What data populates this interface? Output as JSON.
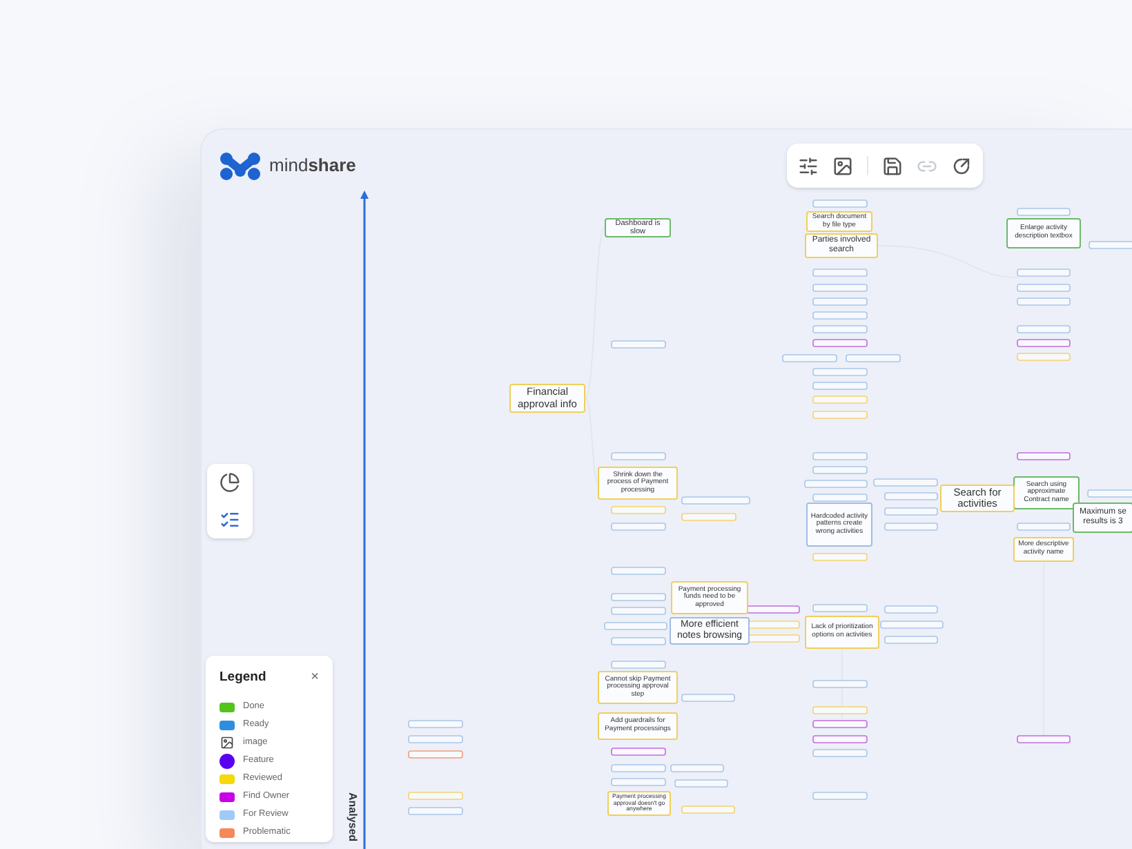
{
  "app": {
    "logo_text": "mind**share**"
  },
  "toolbar": [
    {
      "kind": "sliders",
      "disabled": false
    },
    {
      "kind": "image",
      "disabled": false
    },
    {
      "kind": "save",
      "disabled": false
    },
    {
      "kind": "link",
      "disabled": true
    },
    {
      "kind": "share",
      "disabled": false
    }
  ],
  "side_tools": [
    {
      "kind": "chart",
      "selected": false
    },
    {
      "kind": "list",
      "selected": true
    }
  ],
  "axis": {
    "label": "Analysed"
  },
  "nodes": [
    {
      "text": "Dashboard is slow",
      "color": "#6bb86b"
    },
    {
      "text": "Search document by file type",
      "color": "#f0cf5a"
    },
    {
      "text": "Enlarge activity description textbox",
      "color": "#6bb86b"
    },
    {
      "text": "Parties involved search",
      "color": "#f0cf5a"
    },
    {
      "text": "Financial approval info",
      "color": "#f0cf5a"
    },
    {
      "text": "Shrink down the process of Payment processing",
      "color": "#f0cf5a"
    },
    {
      "text": "Search using approximate Contract name",
      "color": "#6bb86b"
    },
    {
      "text": "Search for activities",
      "color": "#f0cf5a"
    },
    {
      "text": "Hardcoded activity patterns create wrong activities",
      "color": "#9dbde3"
    },
    {
      "text": "Maximum se results is 3",
      "color": "#6bb86b"
    },
    {
      "text": "More descriptive activity name",
      "color": "#f0cf5a"
    },
    {
      "text": "Payment processing funds need to be approved",
      "color": "#f0cf5a"
    },
    {
      "text": "More efficient notes browsing",
      "color": "#9dbde3"
    },
    {
      "text": "Lack of prioritization options on activities",
      "color": "#f0cf5a"
    },
    {
      "text": "Cannot skip Payment processing approval step",
      "color": "#f0cf5a"
    },
    {
      "text": "Add guardrails for Payment processings",
      "color": "#f0cf5a"
    },
    {
      "text": "Payment processing approval doesn't go anywhere",
      "color": "#f0cf5a"
    }
  ],
  "legend": {
    "title": "Legend",
    "close": "×",
    "items": [
      {
        "label": "Done",
        "kind": "swatch",
        "color": "#52c41a"
      },
      {
        "label": "Ready",
        "kind": "swatch",
        "color": "#2f8fdf"
      },
      {
        "label": "image",
        "kind": "image"
      },
      {
        "label": "Feature",
        "kind": "dot",
        "color": "#5a00f0"
      },
      {
        "label": "Reviewed",
        "kind": "swatch",
        "color": "#f5d90a"
      },
      {
        "label": "Find Owner",
        "kind": "swatch",
        "color": "#c800e8"
      },
      {
        "label": "For Review",
        "kind": "swatch",
        "color": "#9ecbf5"
      },
      {
        "label": "Problematic",
        "kind": "swatch",
        "color": "#f5895a"
      }
    ]
  }
}
